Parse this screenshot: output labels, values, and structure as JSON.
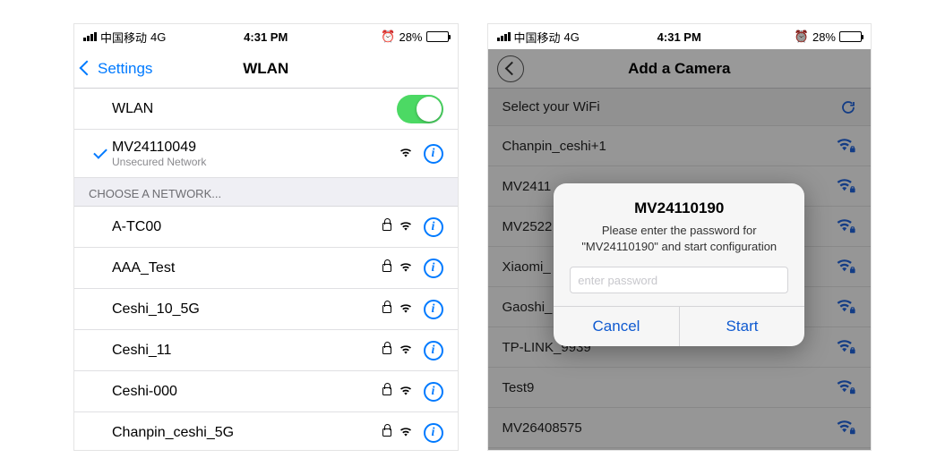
{
  "statusbar": {
    "carrier": "中国移动",
    "network": "4G",
    "time": "4:31 PM",
    "alarm": true,
    "battery_pct": "28%"
  },
  "phoneA": {
    "back_label": "Settings",
    "title": "WLAN",
    "wlan_toggle_label": "WLAN",
    "connected": {
      "ssid": "MV24110049",
      "subtitle": "Unsecured Network"
    },
    "choose_header": "CHOOSE A NETWORK...",
    "networks": [
      {
        "ssid": "A-TC00",
        "locked": true
      },
      {
        "ssid": "AAA_Test",
        "locked": true
      },
      {
        "ssid": "Ceshi_10_5G",
        "locked": true
      },
      {
        "ssid": "Ceshi_11",
        "locked": true
      },
      {
        "ssid": "Ceshi-000",
        "locked": true
      },
      {
        "ssid": "Chanpin_ceshi_5G",
        "locked": true
      }
    ]
  },
  "phoneB": {
    "title": "Add a Camera",
    "select_label": "Select your WiFi",
    "networks": [
      "Chanpin_ceshi+1",
      "MV2411",
      "MV2522",
      "Xiaomi_",
      "Gaoshi_",
      "TP-LINK_9939",
      "Test9",
      "MV26408575"
    ],
    "alert": {
      "title": "MV24110190",
      "message": "Please enter the password for \"MV24110190\" and start configuration",
      "placeholder": "enter password",
      "cancel": "Cancel",
      "start": "Start"
    }
  }
}
